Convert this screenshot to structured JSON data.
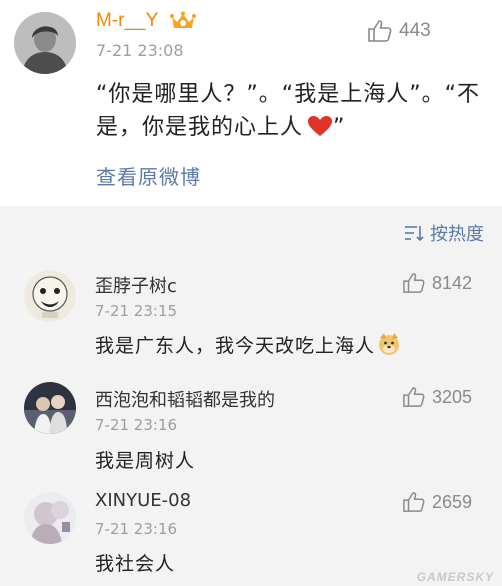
{
  "post": {
    "username": "M-r__Y",
    "time": "7-21 23:08",
    "likes": "443",
    "text": "“你是哪里人？”。“我是上海人”。“不是，你是我的心上人",
    "text_end": "”",
    "view_original": "查看原微博"
  },
  "sort": {
    "label": "按热度"
  },
  "comments": [
    {
      "username": "歪脖子树c",
      "time": "7-21 23:15",
      "likes": "8142",
      "text": "我是广东人，我今天改吃上海人"
    },
    {
      "username": "西泡泡和韬韬都是我的",
      "time": "7-21 23:16",
      "likes": "3205",
      "text": "我是周树人"
    },
    {
      "username": "XINYUE-08",
      "time": "7-21 23:16",
      "likes": "2659",
      "text": "我社会人"
    }
  ],
  "watermark": "GAMERSKY",
  "colors": {
    "username_orange": "#f08700",
    "link_blue": "#5b7aa8",
    "heart_red": "#e0332a"
  }
}
